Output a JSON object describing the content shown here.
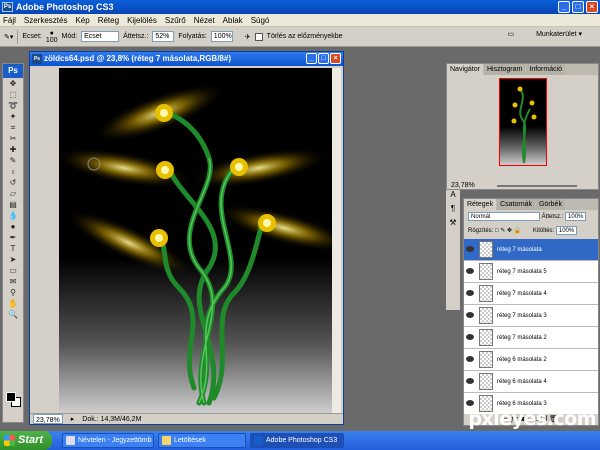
{
  "app": {
    "title": "Adobe Photoshop CS3",
    "icon": "ps-app-icon"
  },
  "menu": [
    "Fájl",
    "Szerkesztés",
    "Kép",
    "Réteg",
    "Kijelölés",
    "Szűrő",
    "Nézet",
    "Ablak",
    "Súgó"
  ],
  "options": {
    "brush_label": "Ecset:",
    "brush_size": "100",
    "mode_label": "Mód:",
    "mode_value": "Ecset",
    "opacity_label": "Áttetsz.:",
    "opacity_value": "52%",
    "flow_label": "Folyatás:",
    "flow_value": "100%",
    "history_label": "Törlés az előzményekbe",
    "workspace_label": "Munkaterület"
  },
  "document": {
    "title": "zöldcs64.psd @ 23,8% (réteg 7 másolata,RGB/8#)",
    "zoom": "23,78%",
    "doc_info": "Dok.: 14,3M/46,2M"
  },
  "navigator": {
    "tabs": [
      "Navigátor",
      "Hisztogram",
      "Információ"
    ],
    "zoom": "23,78%"
  },
  "layers": {
    "tabs": [
      "Rétegek",
      "Csatornák",
      "Görbék"
    ],
    "blend_mode": "Normál",
    "opacity_label": "Áttetsz.:",
    "opacity_value": "100%",
    "lock_label": "Rögzítés:",
    "fill_label": "Kitöltés:",
    "fill_value": "100%",
    "items": [
      {
        "name": "réteg 7 másolata",
        "selected": true
      },
      {
        "name": "réteg 7 másolata 5",
        "selected": false
      },
      {
        "name": "réteg 7 másolata 4",
        "selected": false
      },
      {
        "name": "réteg 7 másolata 3",
        "selected": false
      },
      {
        "name": "réteg 7 másolata 2",
        "selected": false
      },
      {
        "name": "réteg 6 másolata 2",
        "selected": false
      },
      {
        "name": "réteg 6 másolata 4",
        "selected": false
      },
      {
        "name": "réteg 6 másolata 3",
        "selected": false
      }
    ]
  },
  "taskbar": {
    "start": "Start",
    "items": [
      "Névtelen - Jegyzettömb",
      "Letöltések",
      "Adobe Photoshop CS3"
    ]
  },
  "watermark": "pxleyes.com"
}
